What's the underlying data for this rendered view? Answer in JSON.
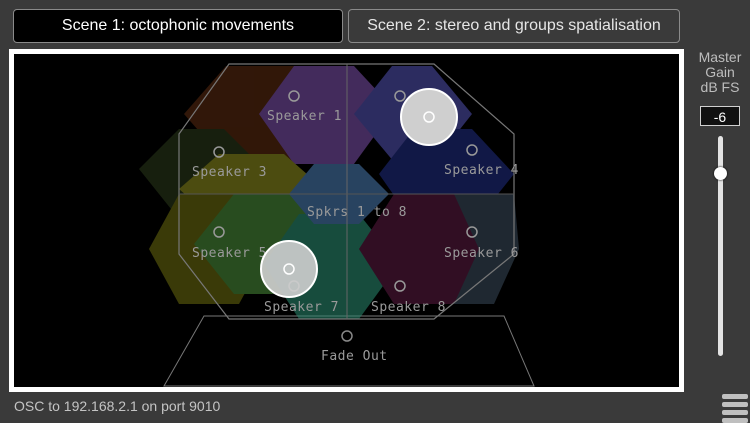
{
  "tabs": [
    {
      "label": "Scene 1: octophonic movements",
      "active": true
    },
    {
      "label": "Scene 2: stereo and groups spatialisation",
      "active": false
    }
  ],
  "stage": {
    "speakers": [
      {
        "label": "Speaker 1",
        "color": "#7a4fa8"
      },
      {
        "label": "Speaker 3",
        "color": "#8a8a1e"
      },
      {
        "label": "Speaker 4",
        "color": "#1f2d80"
      },
      {
        "label": "Spkrs 1 to 8",
        "color": "#4a7ab0"
      },
      {
        "label": "Speaker 5",
        "color": "#4a8a3a"
      },
      {
        "label": "Speaker 6",
        "color": "#5a6a7a"
      },
      {
        "label": "Speaker 7",
        "color": "#2a8a70"
      },
      {
        "label": "Speaker 8",
        "color": "#7a1a40"
      }
    ],
    "fade_out_label": "Fade Out"
  },
  "master_gain": {
    "label_line1": "Master",
    "label_line2": "Gain",
    "label_line3": "dB FS",
    "value": "-6",
    "level_fraction": 0.83
  },
  "status": {
    "text": "OSC to 192.168.2.1 on port 9010"
  },
  "icons": {
    "menu": "hamburger-menu-icon",
    "source": "circle-handle-icon"
  }
}
